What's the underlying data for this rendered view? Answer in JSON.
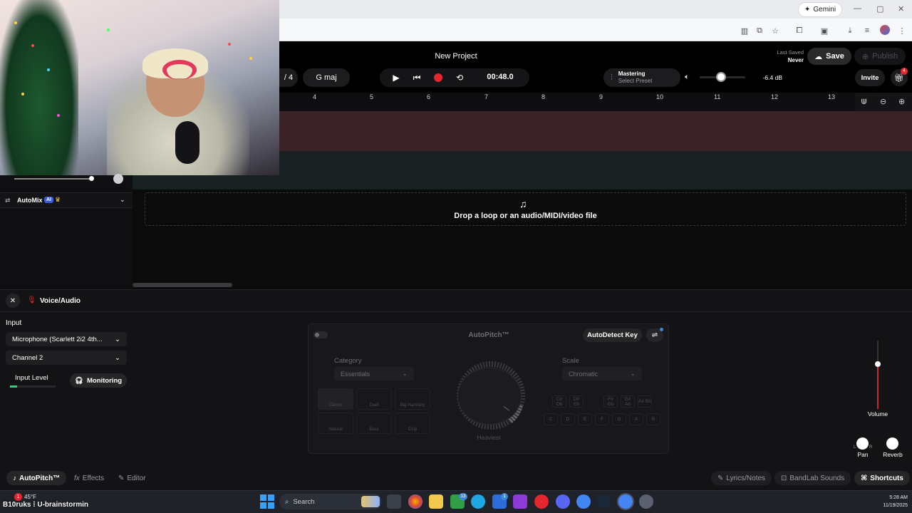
{
  "browser": {
    "gemini_label": "Gemini",
    "window_controls": [
      "—",
      "▢",
      "✕"
    ]
  },
  "project": {
    "title": "New Project",
    "last_saved_label": "Last Saved",
    "last_saved_value": "Never",
    "save_label": "Save",
    "publish_label": "Publish"
  },
  "transport": {
    "time_sig_fragment": "/ 4",
    "key": "G maj",
    "time": "00:48.0"
  },
  "mastering": {
    "label": "Mastering",
    "preset": "Select Preset",
    "db": "-6.4 dB"
  },
  "invite": {
    "label": "Invite",
    "badge": "4"
  },
  "ruler": [
    "4",
    "5",
    "6",
    "7",
    "8",
    "9",
    "10",
    "11",
    "12",
    "13"
  ],
  "tracks": {
    "automix_label": "AutoMix",
    "ai_badge": "AI",
    "drop_text": "Drop a loop or an audio/MIDI/video file"
  },
  "panel": {
    "title": "Voice/Audio",
    "input_label": "Input",
    "input_device": "Microphone (Scarlett 2i2 4th...",
    "channel": "Channel 2",
    "input_level_label": "Input Level",
    "monitoring_label": "Monitoring",
    "input_level_fraction": 0.15
  },
  "autopitch": {
    "title": "AutoPitch™",
    "autodetect_label": "AutoDetect Key",
    "category_label": "Category",
    "category_value": "Essentials",
    "scale_label": "Scale",
    "scale_value": "Chromatic",
    "knob_label": "Heaviest",
    "effects": [
      "Classic",
      "Duet",
      "Big Harmony",
      "Natural",
      "Bass",
      "Chip"
    ],
    "keys_top": [
      "C#\nDb",
      "D#\nEb",
      "F#\nGb",
      "G#\nAb",
      "A#\nBb"
    ],
    "keys_bottom": [
      "C",
      "D",
      "E",
      "F",
      "G",
      "A",
      "B"
    ]
  },
  "mixer": {
    "volume_label": "Volume",
    "pan_label": "Pan",
    "reverb_label": "Reverb",
    "pan_left": "L",
    "pan_right": "R"
  },
  "bottom_tabs": {
    "autopitch": "AutoPitch™",
    "effects": "Effects",
    "editor": "Editor",
    "lyrics": "Lyrics/Notes",
    "sounds": "BandLab Sounds",
    "shortcuts": "Shortcuts"
  },
  "taskbar": {
    "weather_temp": "45°F",
    "search_placeholder": "Search",
    "time": "5:28 AM",
    "date": "11/19/2025",
    "badge_teams": "13",
    "badge_store": "1",
    "badge_weather": "1"
  },
  "stream_overlay": {
    "tag": "B10ruks ⁞ U-brainstormin"
  }
}
